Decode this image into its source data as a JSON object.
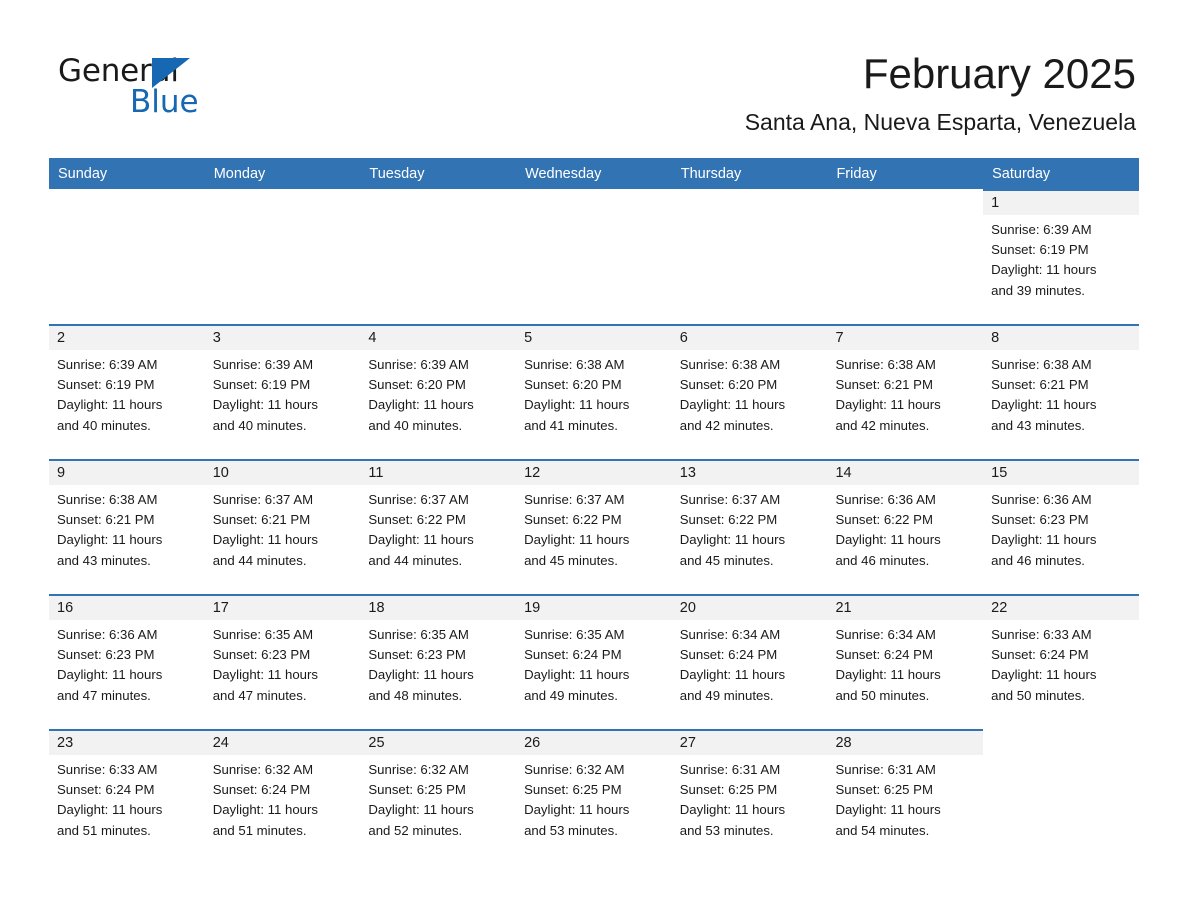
{
  "brand": {
    "word_one": "General",
    "word_two": "Blue",
    "accent_color": "#1668b3"
  },
  "header": {
    "month_title": "February 2025",
    "location": "Santa Ana, Nueva Esparta, Venezuela"
  },
  "calendar": {
    "header_bg": "#3273b4",
    "header_text_color": "#ffffff",
    "day_number_bg": "#f2f2f2",
    "weekdays": [
      "Sunday",
      "Monday",
      "Tuesday",
      "Wednesday",
      "Thursday",
      "Friday",
      "Saturday"
    ],
    "weeks": [
      [
        {
          "day": "",
          "sunrise": "",
          "sunset": "",
          "daylight_line1": "",
          "daylight_line2": "",
          "blank": true
        },
        {
          "day": "",
          "sunrise": "",
          "sunset": "",
          "daylight_line1": "",
          "daylight_line2": "",
          "blank": true
        },
        {
          "day": "",
          "sunrise": "",
          "sunset": "",
          "daylight_line1": "",
          "daylight_line2": "",
          "blank": true
        },
        {
          "day": "",
          "sunrise": "",
          "sunset": "",
          "daylight_line1": "",
          "daylight_line2": "",
          "blank": true
        },
        {
          "day": "",
          "sunrise": "",
          "sunset": "",
          "daylight_line1": "",
          "daylight_line2": "",
          "blank": true
        },
        {
          "day": "",
          "sunrise": "",
          "sunset": "",
          "daylight_line1": "",
          "daylight_line2": "",
          "blank": true
        },
        {
          "day": "1",
          "sunrise": "Sunrise: 6:39 AM",
          "sunset": "Sunset: 6:19 PM",
          "daylight_line1": "Daylight: 11 hours",
          "daylight_line2": "and 39 minutes.",
          "blank": false
        }
      ],
      [
        {
          "day": "2",
          "sunrise": "Sunrise: 6:39 AM",
          "sunset": "Sunset: 6:19 PM",
          "daylight_line1": "Daylight: 11 hours",
          "daylight_line2": "and 40 minutes.",
          "blank": false
        },
        {
          "day": "3",
          "sunrise": "Sunrise: 6:39 AM",
          "sunset": "Sunset: 6:19 PM",
          "daylight_line1": "Daylight: 11 hours",
          "daylight_line2": "and 40 minutes.",
          "blank": false
        },
        {
          "day": "4",
          "sunrise": "Sunrise: 6:39 AM",
          "sunset": "Sunset: 6:20 PM",
          "daylight_line1": "Daylight: 11 hours",
          "daylight_line2": "and 40 minutes.",
          "blank": false
        },
        {
          "day": "5",
          "sunrise": "Sunrise: 6:38 AM",
          "sunset": "Sunset: 6:20 PM",
          "daylight_line1": "Daylight: 11 hours",
          "daylight_line2": "and 41 minutes.",
          "blank": false
        },
        {
          "day": "6",
          "sunrise": "Sunrise: 6:38 AM",
          "sunset": "Sunset: 6:20 PM",
          "daylight_line1": "Daylight: 11 hours",
          "daylight_line2": "and 42 minutes.",
          "blank": false
        },
        {
          "day": "7",
          "sunrise": "Sunrise: 6:38 AM",
          "sunset": "Sunset: 6:21 PM",
          "daylight_line1": "Daylight: 11 hours",
          "daylight_line2": "and 42 minutes.",
          "blank": false
        },
        {
          "day": "8",
          "sunrise": "Sunrise: 6:38 AM",
          "sunset": "Sunset: 6:21 PM",
          "daylight_line1": "Daylight: 11 hours",
          "daylight_line2": "and 43 minutes.",
          "blank": false
        }
      ],
      [
        {
          "day": "9",
          "sunrise": "Sunrise: 6:38 AM",
          "sunset": "Sunset: 6:21 PM",
          "daylight_line1": "Daylight: 11 hours",
          "daylight_line2": "and 43 minutes.",
          "blank": false
        },
        {
          "day": "10",
          "sunrise": "Sunrise: 6:37 AM",
          "sunset": "Sunset: 6:21 PM",
          "daylight_line1": "Daylight: 11 hours",
          "daylight_line2": "and 44 minutes.",
          "blank": false
        },
        {
          "day": "11",
          "sunrise": "Sunrise: 6:37 AM",
          "sunset": "Sunset: 6:22 PM",
          "daylight_line1": "Daylight: 11 hours",
          "daylight_line2": "and 44 minutes.",
          "blank": false
        },
        {
          "day": "12",
          "sunrise": "Sunrise: 6:37 AM",
          "sunset": "Sunset: 6:22 PM",
          "daylight_line1": "Daylight: 11 hours",
          "daylight_line2": "and 45 minutes.",
          "blank": false
        },
        {
          "day": "13",
          "sunrise": "Sunrise: 6:37 AM",
          "sunset": "Sunset: 6:22 PM",
          "daylight_line1": "Daylight: 11 hours",
          "daylight_line2": "and 45 minutes.",
          "blank": false
        },
        {
          "day": "14",
          "sunrise": "Sunrise: 6:36 AM",
          "sunset": "Sunset: 6:22 PM",
          "daylight_line1": "Daylight: 11 hours",
          "daylight_line2": "and 46 minutes.",
          "blank": false
        },
        {
          "day": "15",
          "sunrise": "Sunrise: 6:36 AM",
          "sunset": "Sunset: 6:23 PM",
          "daylight_line1": "Daylight: 11 hours",
          "daylight_line2": "and 46 minutes.",
          "blank": false
        }
      ],
      [
        {
          "day": "16",
          "sunrise": "Sunrise: 6:36 AM",
          "sunset": "Sunset: 6:23 PM",
          "daylight_line1": "Daylight: 11 hours",
          "daylight_line2": "and 47 minutes.",
          "blank": false
        },
        {
          "day": "17",
          "sunrise": "Sunrise: 6:35 AM",
          "sunset": "Sunset: 6:23 PM",
          "daylight_line1": "Daylight: 11 hours",
          "daylight_line2": "and 47 minutes.",
          "blank": false
        },
        {
          "day": "18",
          "sunrise": "Sunrise: 6:35 AM",
          "sunset": "Sunset: 6:23 PM",
          "daylight_line1": "Daylight: 11 hours",
          "daylight_line2": "and 48 minutes.",
          "blank": false
        },
        {
          "day": "19",
          "sunrise": "Sunrise: 6:35 AM",
          "sunset": "Sunset: 6:24 PM",
          "daylight_line1": "Daylight: 11 hours",
          "daylight_line2": "and 49 minutes.",
          "blank": false
        },
        {
          "day": "20",
          "sunrise": "Sunrise: 6:34 AM",
          "sunset": "Sunset: 6:24 PM",
          "daylight_line1": "Daylight: 11 hours",
          "daylight_line2": "and 49 minutes.",
          "blank": false
        },
        {
          "day": "21",
          "sunrise": "Sunrise: 6:34 AM",
          "sunset": "Sunset: 6:24 PM",
          "daylight_line1": "Daylight: 11 hours",
          "daylight_line2": "and 50 minutes.",
          "blank": false
        },
        {
          "day": "22",
          "sunrise": "Sunrise: 6:33 AM",
          "sunset": "Sunset: 6:24 PM",
          "daylight_line1": "Daylight: 11 hours",
          "daylight_line2": "and 50 minutes.",
          "blank": false
        }
      ],
      [
        {
          "day": "23",
          "sunrise": "Sunrise: 6:33 AM",
          "sunset": "Sunset: 6:24 PM",
          "daylight_line1": "Daylight: 11 hours",
          "daylight_line2": "and 51 minutes.",
          "blank": false
        },
        {
          "day": "24",
          "sunrise": "Sunrise: 6:32 AM",
          "sunset": "Sunset: 6:24 PM",
          "daylight_line1": "Daylight: 11 hours",
          "daylight_line2": "and 51 minutes.",
          "blank": false
        },
        {
          "day": "25",
          "sunrise": "Sunrise: 6:32 AM",
          "sunset": "Sunset: 6:25 PM",
          "daylight_line1": "Daylight: 11 hours",
          "daylight_line2": "and 52 minutes.",
          "blank": false
        },
        {
          "day": "26",
          "sunrise": "Sunrise: 6:32 AM",
          "sunset": "Sunset: 6:25 PM",
          "daylight_line1": "Daylight: 11 hours",
          "daylight_line2": "and 53 minutes.",
          "blank": false
        },
        {
          "day": "27",
          "sunrise": "Sunrise: 6:31 AM",
          "sunset": "Sunset: 6:25 PM",
          "daylight_line1": "Daylight: 11 hours",
          "daylight_line2": "and 53 minutes.",
          "blank": false
        },
        {
          "day": "28",
          "sunrise": "Sunrise: 6:31 AM",
          "sunset": "Sunset: 6:25 PM",
          "daylight_line1": "Daylight: 11 hours",
          "daylight_line2": "and 54 minutes.",
          "blank": false
        },
        {
          "day": "",
          "sunrise": "",
          "sunset": "",
          "daylight_line1": "",
          "daylight_line2": "",
          "blank": true
        }
      ]
    ]
  }
}
